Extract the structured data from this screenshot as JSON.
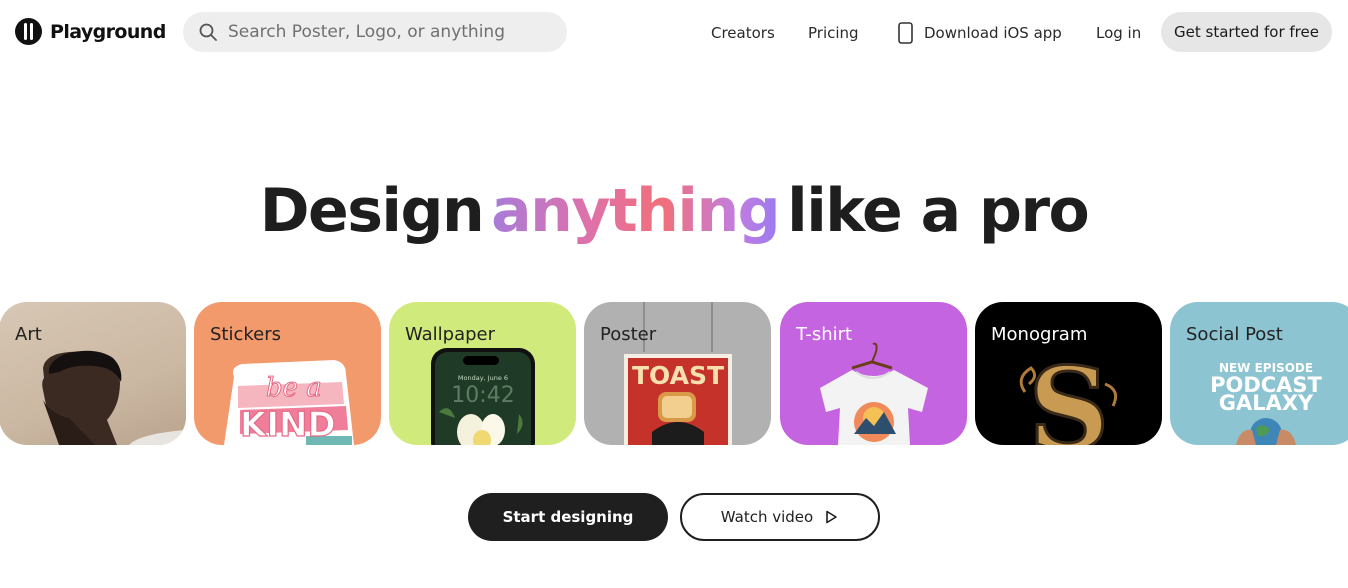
{
  "brand": {
    "name": "Playground"
  },
  "search": {
    "placeholder": "Search Poster, Logo, or anything"
  },
  "nav": {
    "creators": "Creators",
    "pricing": "Pricing",
    "ios": "Download iOS app",
    "login": "Log in",
    "cta": "Get started for free"
  },
  "hero": {
    "before": "Design",
    "highlight": "anything",
    "after": "like a pro"
  },
  "categories": [
    {
      "label": "Art"
    },
    {
      "label": "Stickers",
      "art_text": [
        "be a",
        "KIND"
      ]
    },
    {
      "label": "Wallpaper",
      "art_text": [
        "Monday, June 6",
        "10:42"
      ]
    },
    {
      "label": "Poster",
      "art_text": [
        "TOAST"
      ]
    },
    {
      "label": "T-shirt"
    },
    {
      "label": "Monogram",
      "art_text": [
        "S"
      ]
    },
    {
      "label": "Social Post",
      "art_text": [
        "NEW EPISODE",
        "PODCAST",
        "GALAXY"
      ]
    }
  ],
  "actions": {
    "start": "Start designing",
    "watch": "Watch video"
  },
  "colors": {
    "accent_gradient": [
      "#a77cd9",
      "#e071a8",
      "#f0707a",
      "#9b7af0"
    ],
    "primary_button": "#1f1f1f",
    "search_bg": "#eeeeee"
  }
}
